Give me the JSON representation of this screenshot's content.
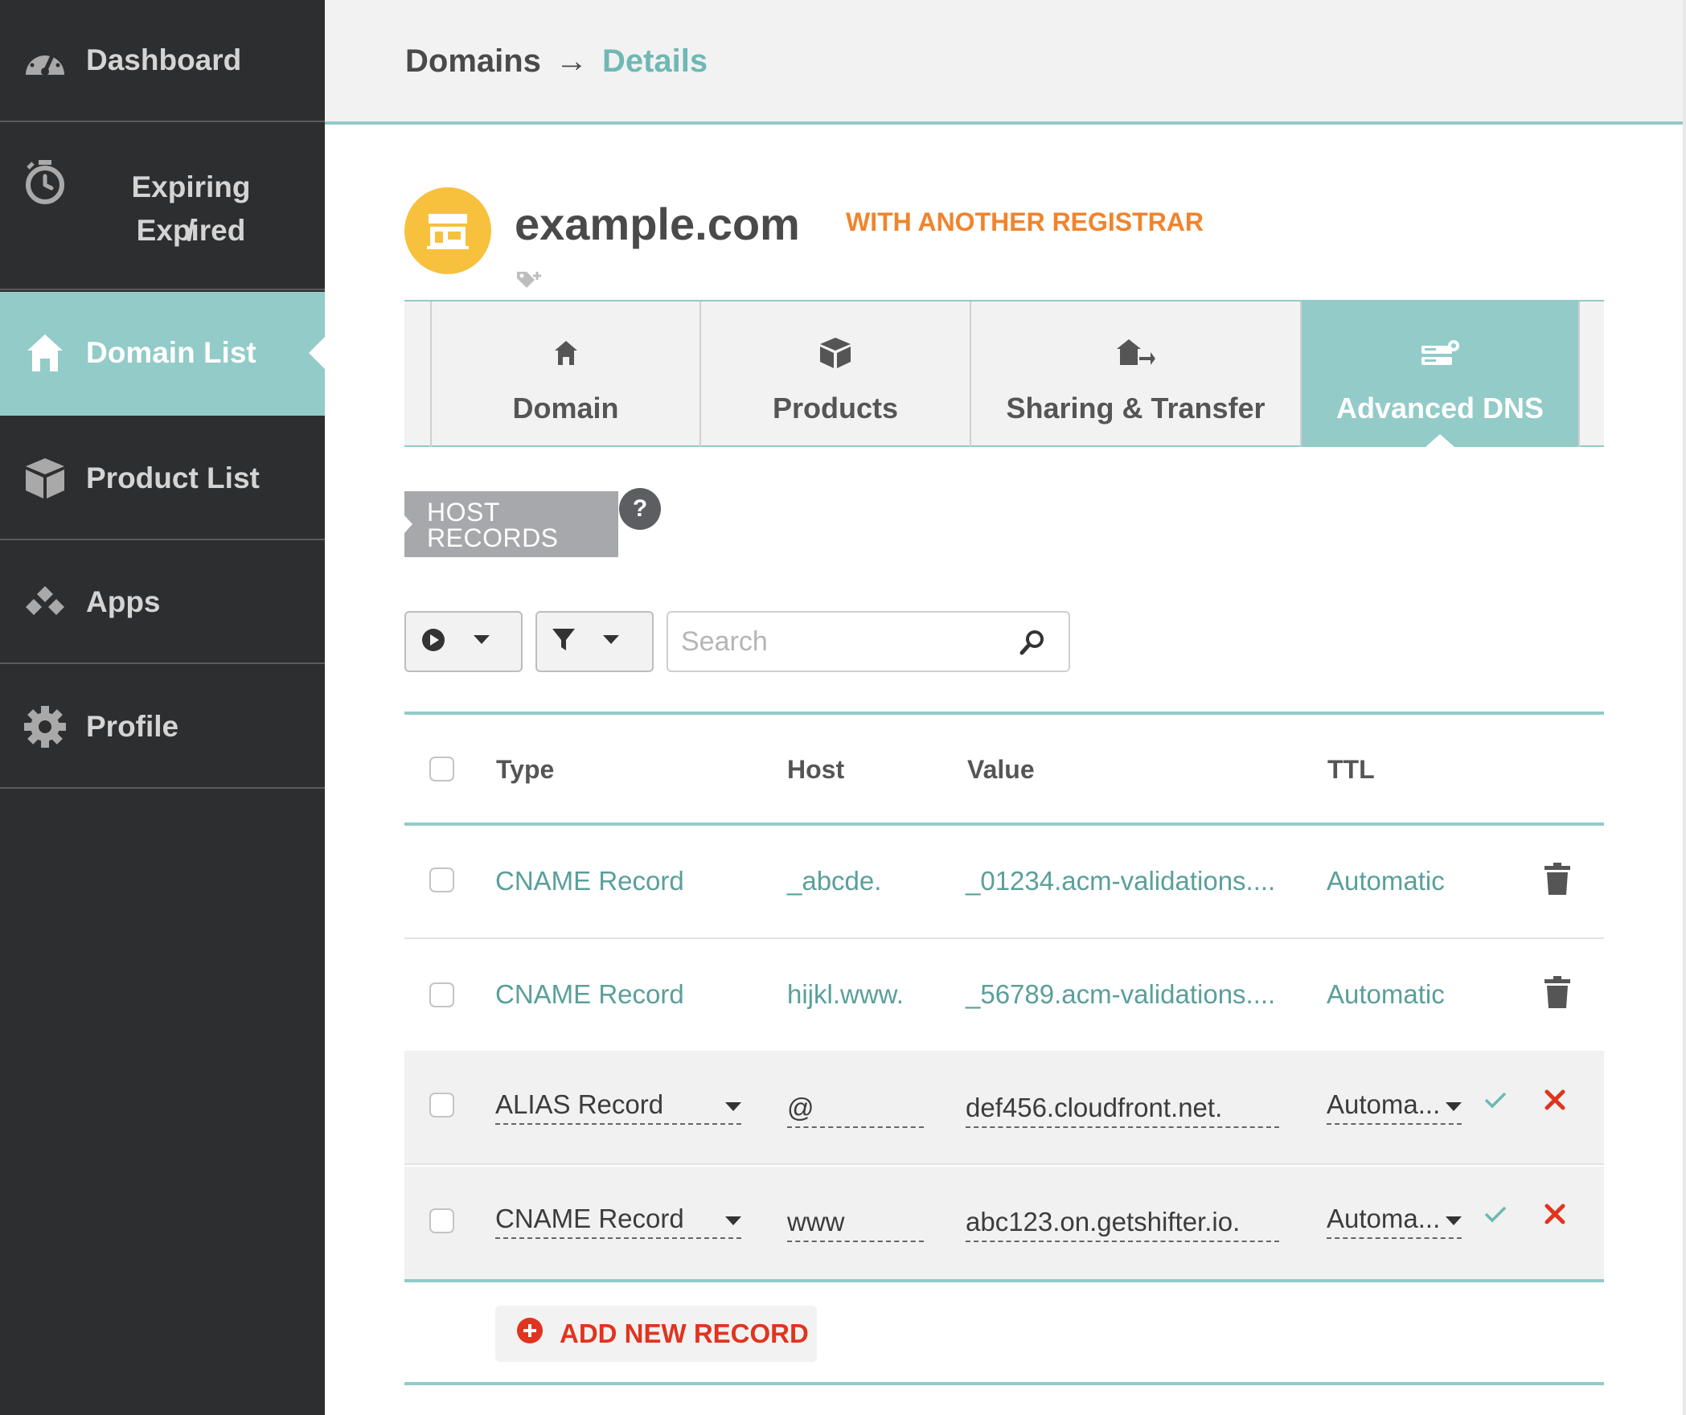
{
  "sidebar": {
    "items": [
      {
        "label": "Dashboard",
        "icon": "speedometer-icon"
      },
      {
        "label_line1": "Expiring /",
        "label_line2": "Expired",
        "icon": "stopwatch-icon"
      },
      {
        "label": "Domain List",
        "icon": "home-icon",
        "active": true
      },
      {
        "label": "Product List",
        "icon": "box-icon"
      },
      {
        "label": "Apps",
        "icon": "apps-icon"
      },
      {
        "label": "Profile",
        "icon": "gear-icon"
      }
    ]
  },
  "header": {
    "breadcrumb_root": "Domains",
    "breadcrumb_arrow": "→",
    "breadcrumb_current": "Details"
  },
  "domain": {
    "name": "example.com",
    "status": "WITH ANOTHER REGISTRAR",
    "logo_icon": "storefront-icon"
  },
  "tabs": [
    {
      "label": "Domain",
      "icon": "home-icon"
    },
    {
      "label": "Products",
      "icon": "box-icon"
    },
    {
      "label": "Sharing & Transfer",
      "icon": "house-transfer-icon"
    },
    {
      "label": "Advanced DNS",
      "icon": "server-gear-icon",
      "active": true
    }
  ],
  "host_records": {
    "label_line1": "HOST",
    "label_line2": "RECORDS",
    "help": "?"
  },
  "toolbar": {
    "search_placeholder": "Search"
  },
  "table": {
    "columns": [
      "Type",
      "Host",
      "Value",
      "TTL"
    ],
    "rows": [
      {
        "type": "CNAME Record",
        "host": "_abcde.",
        "value": "_01234.acm-validations....",
        "ttl": "Automatic",
        "mode": "view"
      },
      {
        "type": "CNAME Record",
        "host": "hijkl.www.",
        "value": "_56789.acm-validations....",
        "ttl": "Automatic",
        "mode": "view"
      },
      {
        "type": "ALIAS Record",
        "host": "@",
        "value": "def456.cloudfront.net.",
        "ttl": "Automa...",
        "mode": "edit"
      },
      {
        "type": "CNAME Record",
        "host": "www",
        "value": "abc123.on.getshifter.io.",
        "ttl": "Automa...",
        "mode": "edit"
      }
    ],
    "add_label": "ADD NEW RECORD"
  },
  "colors": {
    "sidebar_bg": "#2d2e30",
    "accent": "#92cbc8",
    "status_orange": "#f0842c",
    "danger": "#e0341f",
    "logo_yellow": "#f7c13d"
  }
}
